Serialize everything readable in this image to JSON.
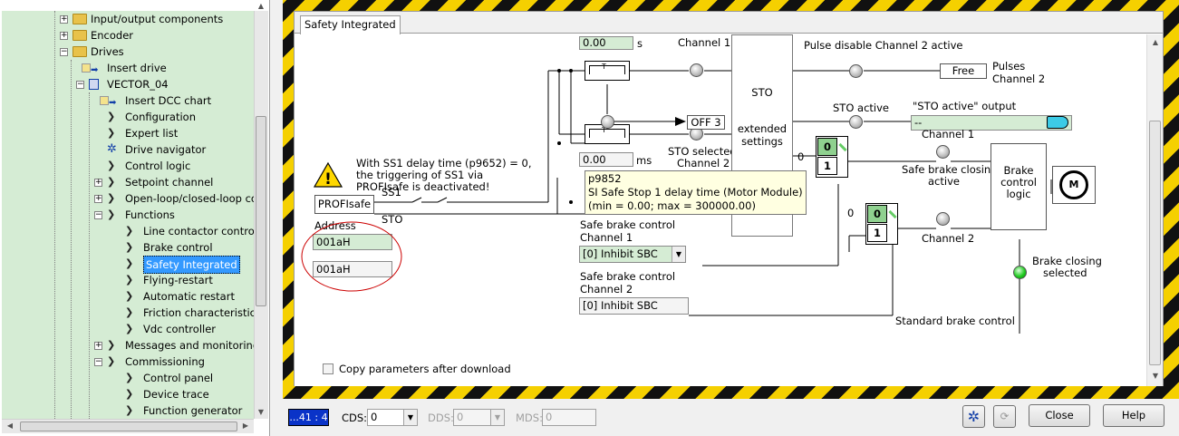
{
  "tree": {
    "items": [
      {
        "label": "Input/output components",
        "indent": 1,
        "icon": "folder-icon",
        "expander": "+"
      },
      {
        "label": "Encoder",
        "indent": 1,
        "icon": "folder-icon",
        "expander": "+"
      },
      {
        "label": "Drives",
        "indent": 1,
        "icon": "folder-icon",
        "expander": "-"
      },
      {
        "label": "Insert drive",
        "indent": 2,
        "icon": "insert-icon",
        "expander": ""
      },
      {
        "label": "VECTOR_04",
        "indent": 2,
        "icon": "drive-icon",
        "expander": "-"
      },
      {
        "label": "Insert DCC chart",
        "indent": 3,
        "icon": "insert-icon",
        "expander": ""
      },
      {
        "label": "Configuration",
        "indent": 3,
        "icon": "chevron-icon",
        "expander": ""
      },
      {
        "label": "Expert list",
        "indent": 3,
        "icon": "chevron-icon",
        "expander": ""
      },
      {
        "label": "Drive navigator",
        "indent": 3,
        "icon": "gear-icon",
        "expander": ""
      },
      {
        "label": "Control logic",
        "indent": 3,
        "icon": "chevron-icon",
        "expander": ""
      },
      {
        "label": "Setpoint channel",
        "indent": 3,
        "icon": "chevron-icon",
        "expander": "+"
      },
      {
        "label": "Open-loop/closed-loop co",
        "indent": 3,
        "icon": "chevron-icon",
        "expander": "+"
      },
      {
        "label": "Functions",
        "indent": 3,
        "icon": "chevron-icon",
        "expander": "-"
      },
      {
        "label": "Line contactor control",
        "indent": 4,
        "icon": "chevron-icon",
        "expander": ""
      },
      {
        "label": "Brake control",
        "indent": 4,
        "icon": "chevron-icon",
        "expander": ""
      },
      {
        "label": "Safety Integrated",
        "indent": 4,
        "icon": "chevron-icon",
        "expander": "",
        "selected": true
      },
      {
        "label": "Flying-restart",
        "indent": 4,
        "icon": "chevron-icon",
        "expander": ""
      },
      {
        "label": "Automatic restart",
        "indent": 4,
        "icon": "chevron-icon",
        "expander": ""
      },
      {
        "label": "Friction characteristic",
        "indent": 4,
        "icon": "chevron-icon",
        "expander": ""
      },
      {
        "label": "Vdc controller",
        "indent": 4,
        "icon": "chevron-icon",
        "expander": ""
      },
      {
        "label": "Messages and monitoring",
        "indent": 3,
        "icon": "chevron-icon",
        "expander": "+"
      },
      {
        "label": "Commissioning",
        "indent": 3,
        "icon": "chevron-icon",
        "expander": "-"
      },
      {
        "label": "Control panel",
        "indent": 4,
        "icon": "chevron-icon",
        "expander": ""
      },
      {
        "label": "Device trace",
        "indent": 4,
        "icon": "chevron-icon",
        "expander": ""
      },
      {
        "label": "Function generator",
        "indent": 4,
        "icon": "chevron-icon",
        "expander": ""
      }
    ]
  },
  "dialog": {
    "tab_label": "Safety Integrated",
    "warning": {
      "line1": "With SS1 delay time (p9652) = 0,",
      "line2": "the triggering of SS1 via",
      "line3": "PROFIsafe is deactivated!"
    },
    "profisafe_label": "PROFIsafe",
    "ss1_label": "SS1",
    "sto_label": "STO",
    "address_label": "Address",
    "address1": "001aH",
    "address2": "001aH",
    "time1_value": "0.00",
    "time1_unit": "s",
    "time2_value": "0.00",
    "time2_unit": "ms",
    "channel1": "Channel 1",
    "off3": "OFF 3",
    "sto_selected_line1": "STO selected",
    "sto_selected_line2": "Channel 2",
    "sto_block_title": "STO",
    "sto_block_line2": "extended",
    "sto_block_line3": "settings",
    "pulse_disable": "Pulse disable Channel 2 active",
    "free": "Free",
    "pulses_line1": "Pulses",
    "pulses_line2": "Channel 2",
    "sto_active": "STO active",
    "sto_active_output": "\"STO active\" output",
    "sto_output_value": "--",
    "sw_zero": "0",
    "sw_one": "1",
    "sw_input_zero": "0",
    "sbc_channel1_right": "Channel 1",
    "safe_brake_closing_line1": "Safe brake closing",
    "safe_brake_closing_line2": "active",
    "brake_logic_line1": "Brake",
    "brake_logic_line2": "control",
    "brake_logic_line3": "logic",
    "motor": "M",
    "sbc_channel2_right": "Channel 2",
    "brake_closing_line1": "Brake closing",
    "brake_closing_line2": "selected",
    "sbc1_label1": "Safe brake control",
    "sbc1_label2": "Channel 1",
    "sbc1_value": "[0] Inhibit SBC",
    "sbc2_label1": "Safe brake control",
    "sbc2_label2": "Channel 2",
    "sbc2_value": "[0] Inhibit SBC",
    "standard_brake": "Standard brake control",
    "copy_params": "Copy parameters after download",
    "tooltip": {
      "line1": "p9852",
      "line2": "SI Safe Stop 1 delay time (Motor Module)",
      "line3": "(min = 0.00; max = 300000.00)"
    }
  },
  "statusbar": {
    "position": "...41 : 4",
    "cds_label": "CDS:",
    "cds_value": "0",
    "dds_label": "DDS:",
    "dds_value": "0",
    "mds_label": "MDS:",
    "mds_value": "0",
    "close_label": "Close",
    "help_label": "Help"
  },
  "colors": {
    "tree_bg": "#d5ecd4",
    "hazard_yellow": "#f5d000",
    "selection": "#3399ff",
    "tooltip_bg": "#ffffe1",
    "output_button": "#3ccbe6"
  }
}
